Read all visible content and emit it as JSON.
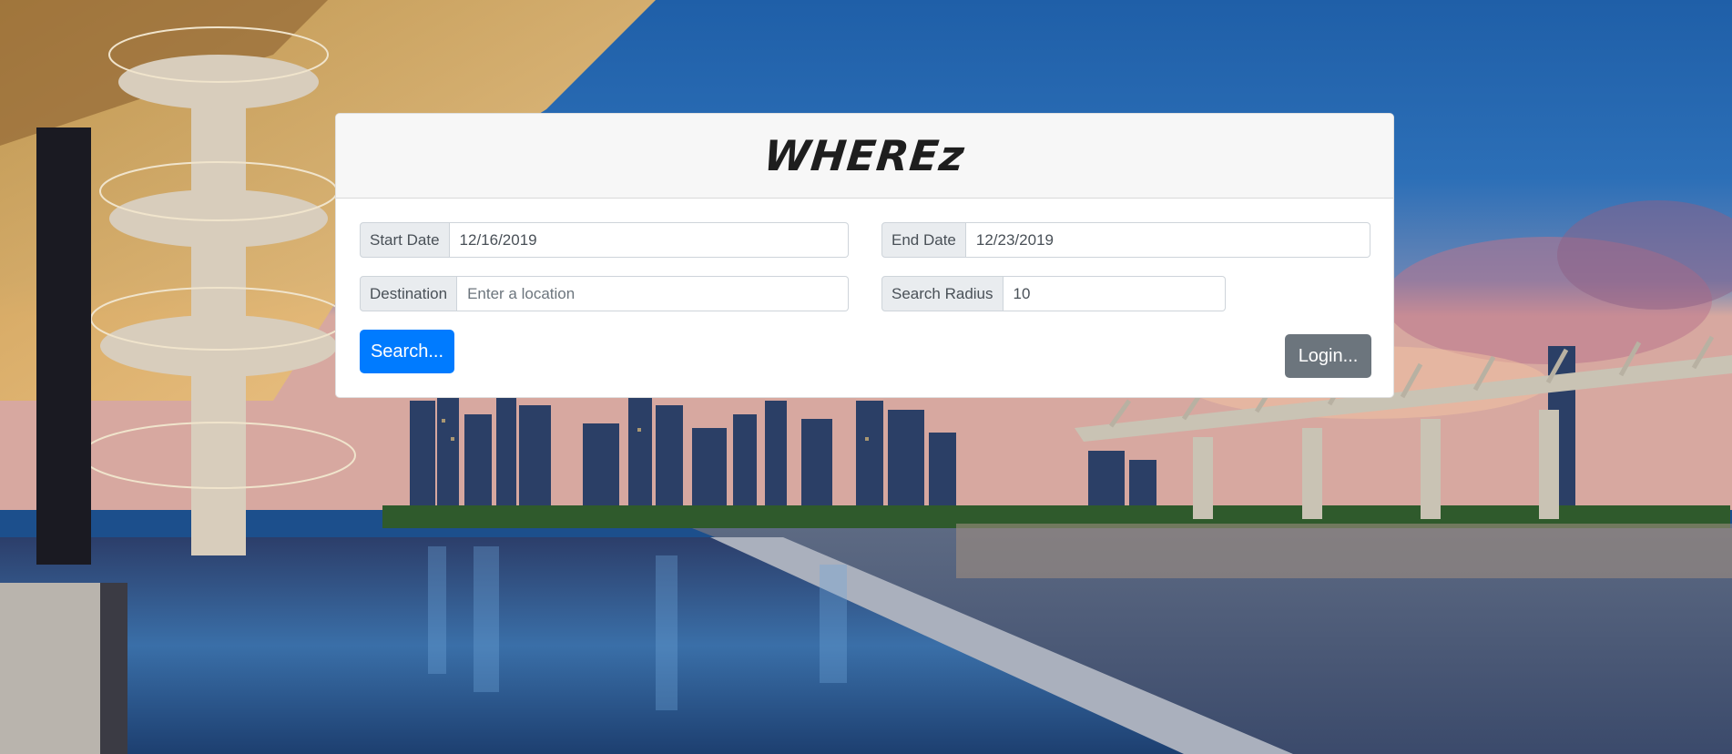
{
  "app": {
    "logo": "WHEREz"
  },
  "form": {
    "start_date": {
      "label": "Start Date",
      "value": "12/16/2019"
    },
    "end_date": {
      "label": "End Date",
      "value": "12/23/2019"
    },
    "destination": {
      "label": "Destination",
      "value": "",
      "placeholder": "Enter a location"
    },
    "search_radius": {
      "label": "Search Radius",
      "value": "10"
    }
  },
  "buttons": {
    "search_label": "Search...",
    "login_label": "Login..."
  },
  "colors": {
    "primary": "#007bff",
    "secondary": "#6c757d",
    "header_bg": "#f7f7f7",
    "addon_bg": "#e9ecef"
  },
  "background": {
    "scene": "city-skyline-waterfront-photo"
  }
}
